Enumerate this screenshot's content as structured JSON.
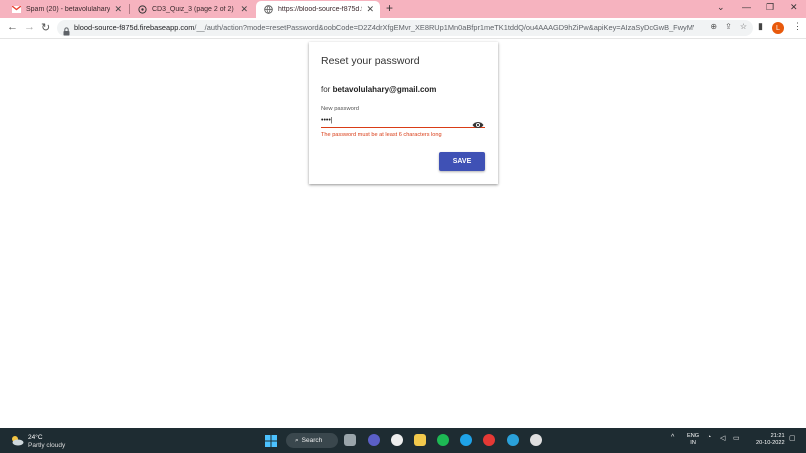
{
  "browser": {
    "tabs": [
      {
        "title": "Spam (20) - betavolulahary@gm...",
        "icon": "gmail-icon",
        "active": false
      },
      {
        "title": "CD3_Quiz_3 (page 2 of 2)",
        "icon": "chatgpt-icon",
        "active": false
      },
      {
        "title": "https://blood-source-f875d.fireb...",
        "icon": "globe-icon",
        "active": true
      }
    ],
    "new_tab": "+",
    "url_host": "blood-source-f875d.firebaseapp.com",
    "url_path": "/__/auth/action?mode=resetPassword&oobCode=D2Z4drXfgEMvr_XE8RUp1Mn0aBfpr1meTK1tddQ/ou4AAAGD9hZiPw&apiKey=AIzaSyDcGwB_FwyMVCy...",
    "avatar_letter": "L"
  },
  "card": {
    "title": "Reset your password",
    "for_prefix": "for",
    "email": "betavolulahary@gmail.com",
    "password_label": "New password",
    "password_value": "••••|",
    "error": "The password must be at least 6 characters long",
    "save_label": "SAVE"
  },
  "taskbar": {
    "temperature": "24°C",
    "weather": "Partly cloudy",
    "search_label": "Search",
    "lang1": "ENG",
    "lang2": "IN",
    "time": "21:21",
    "date": "20-10-2022"
  },
  "colors": {
    "tabstrip": "#f6b3bf",
    "accent": "#3f51b5",
    "error": "#d93c16",
    "taskbar": "#1e2c32"
  }
}
